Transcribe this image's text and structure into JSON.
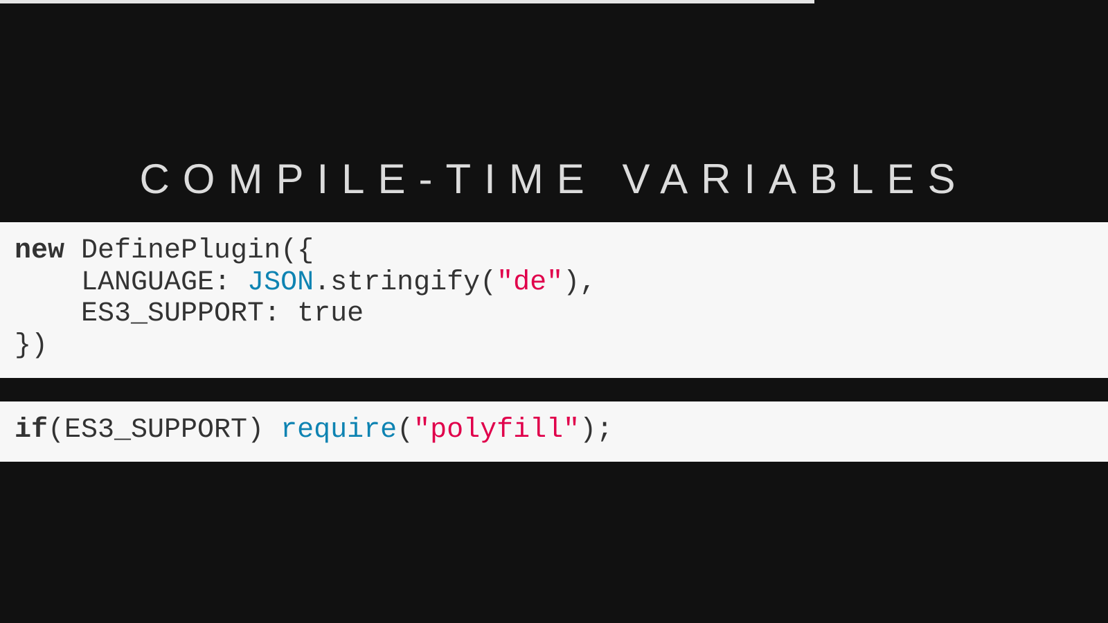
{
  "slide": {
    "title": "COMPILE-TIME VARIABLES",
    "progress": 0.735
  },
  "code_block_1": {
    "lines": [
      [
        {
          "text": "new",
          "style": "keyword"
        },
        {
          "text": " DefinePlugin({",
          "style": "plain"
        }
      ],
      [
        {
          "text": "    LANGUAGE: ",
          "style": "plain"
        },
        {
          "text": "JSON",
          "style": "builtin"
        },
        {
          "text": ".stringify(",
          "style": "plain"
        },
        {
          "text": "\"de\"",
          "style": "string"
        },
        {
          "text": "),",
          "style": "plain"
        }
      ],
      [
        {
          "text": "    ES3_SUPPORT: true",
          "style": "plain"
        }
      ],
      [
        {
          "text": "})",
          "style": "plain"
        }
      ]
    ]
  },
  "code_block_2": {
    "lines": [
      [
        {
          "text": "if",
          "style": "keyword"
        },
        {
          "text": "(ES3_SUPPORT) ",
          "style": "plain"
        },
        {
          "text": "require",
          "style": "builtin"
        },
        {
          "text": "(",
          "style": "plain"
        },
        {
          "text": "\"polyfill\"",
          "style": "string"
        },
        {
          "text": ");",
          "style": "plain"
        }
      ]
    ]
  },
  "colors": {
    "background": "#111111",
    "code_background": "#f7f7f7",
    "title": "#dcdcdc",
    "keyword": "#333333",
    "builtin": "#0e83b2",
    "string": "#e0004b",
    "progress": "#e6e6e6"
  }
}
